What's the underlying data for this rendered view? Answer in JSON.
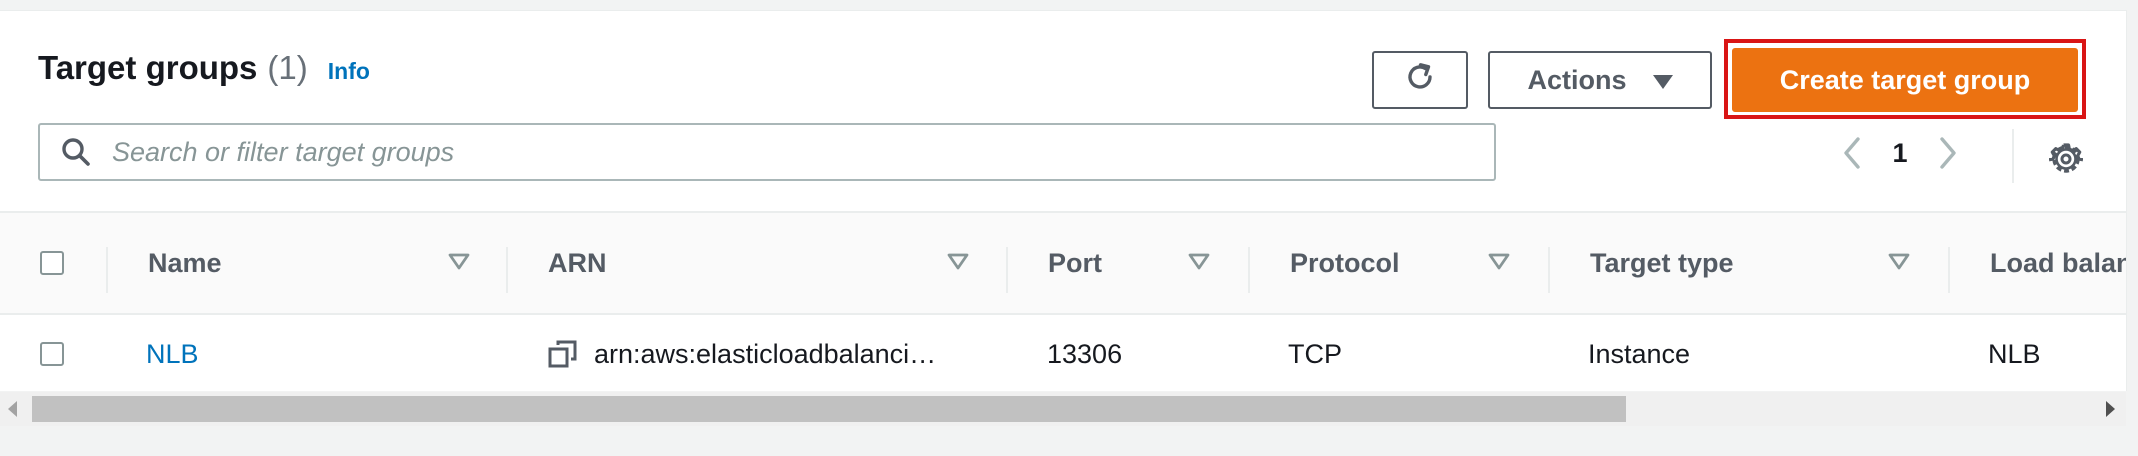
{
  "header": {
    "title": "Target groups",
    "count": "(1)",
    "info_label": "Info"
  },
  "toolbar": {
    "refresh_icon": "refresh-icon",
    "actions_label": "Actions",
    "create_label": "Create target group",
    "highlight_color": "#d91515",
    "accent_color": "#ec7211"
  },
  "search": {
    "placeholder": "Search or filter target groups",
    "value": ""
  },
  "pagination": {
    "current_page": "1"
  },
  "table": {
    "columns": [
      "Name",
      "ARN",
      "Port",
      "Protocol",
      "Target type",
      "Load balan"
    ],
    "rows": [
      {
        "name": "NLB",
        "arn": "arn:aws:elasticloadbalanci…",
        "port": "13306",
        "protocol": "TCP",
        "target_type": "Instance",
        "load_balancer": "NLB"
      }
    ]
  }
}
